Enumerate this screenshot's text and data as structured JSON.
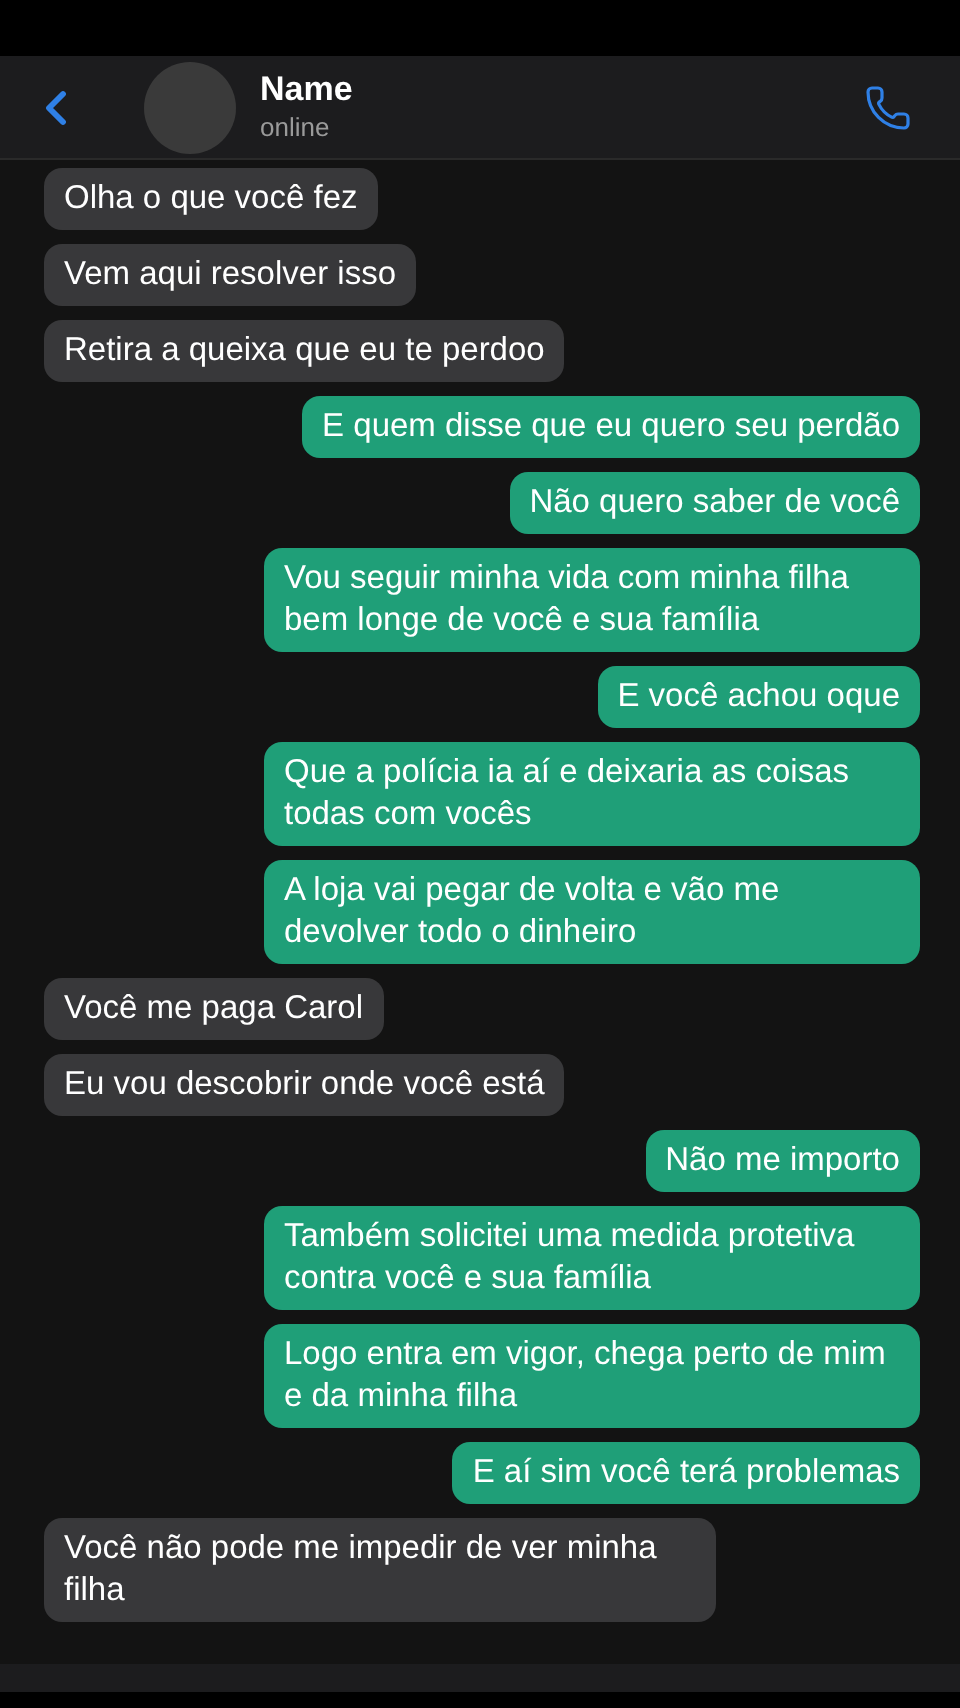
{
  "header": {
    "name": "Name",
    "status": "online"
  },
  "messages": [
    {
      "kind": "in",
      "text": "Olha o que você fez"
    },
    {
      "kind": "in",
      "text": "Vem aqui resolver isso"
    },
    {
      "kind": "in",
      "text": "Retira a queixa que eu te perdoo"
    },
    {
      "kind": "out",
      "text": "E quem disse que eu quero seu perdão"
    },
    {
      "kind": "out",
      "text": "Não quero saber de você"
    },
    {
      "kind": "out",
      "text": "Vou seguir minha vida com minha filha bem longe de você e sua família"
    },
    {
      "kind": "out",
      "text": "E você achou oque"
    },
    {
      "kind": "out",
      "text": "Que a polícia ia aí e deixaria as coisas todas com vocês"
    },
    {
      "kind": "out",
      "text": "A loja vai pegar de volta e vão me devolver todo o dinheiro"
    },
    {
      "kind": "in",
      "text": "Você me paga Carol"
    },
    {
      "kind": "in",
      "text": "Eu vou descobrir onde você está"
    },
    {
      "kind": "out",
      "text": "Não me importo"
    },
    {
      "kind": "out",
      "text": "Também solicitei uma medida protetiva contra você e sua família"
    },
    {
      "kind": "out",
      "text": "Logo entra em vigor, chega perto de mim e da minha filha"
    },
    {
      "kind": "out",
      "text": "E aí sim você terá problemas"
    },
    {
      "kind": "in",
      "text": "Você não pode me impedir de ver minha filha"
    }
  ]
}
